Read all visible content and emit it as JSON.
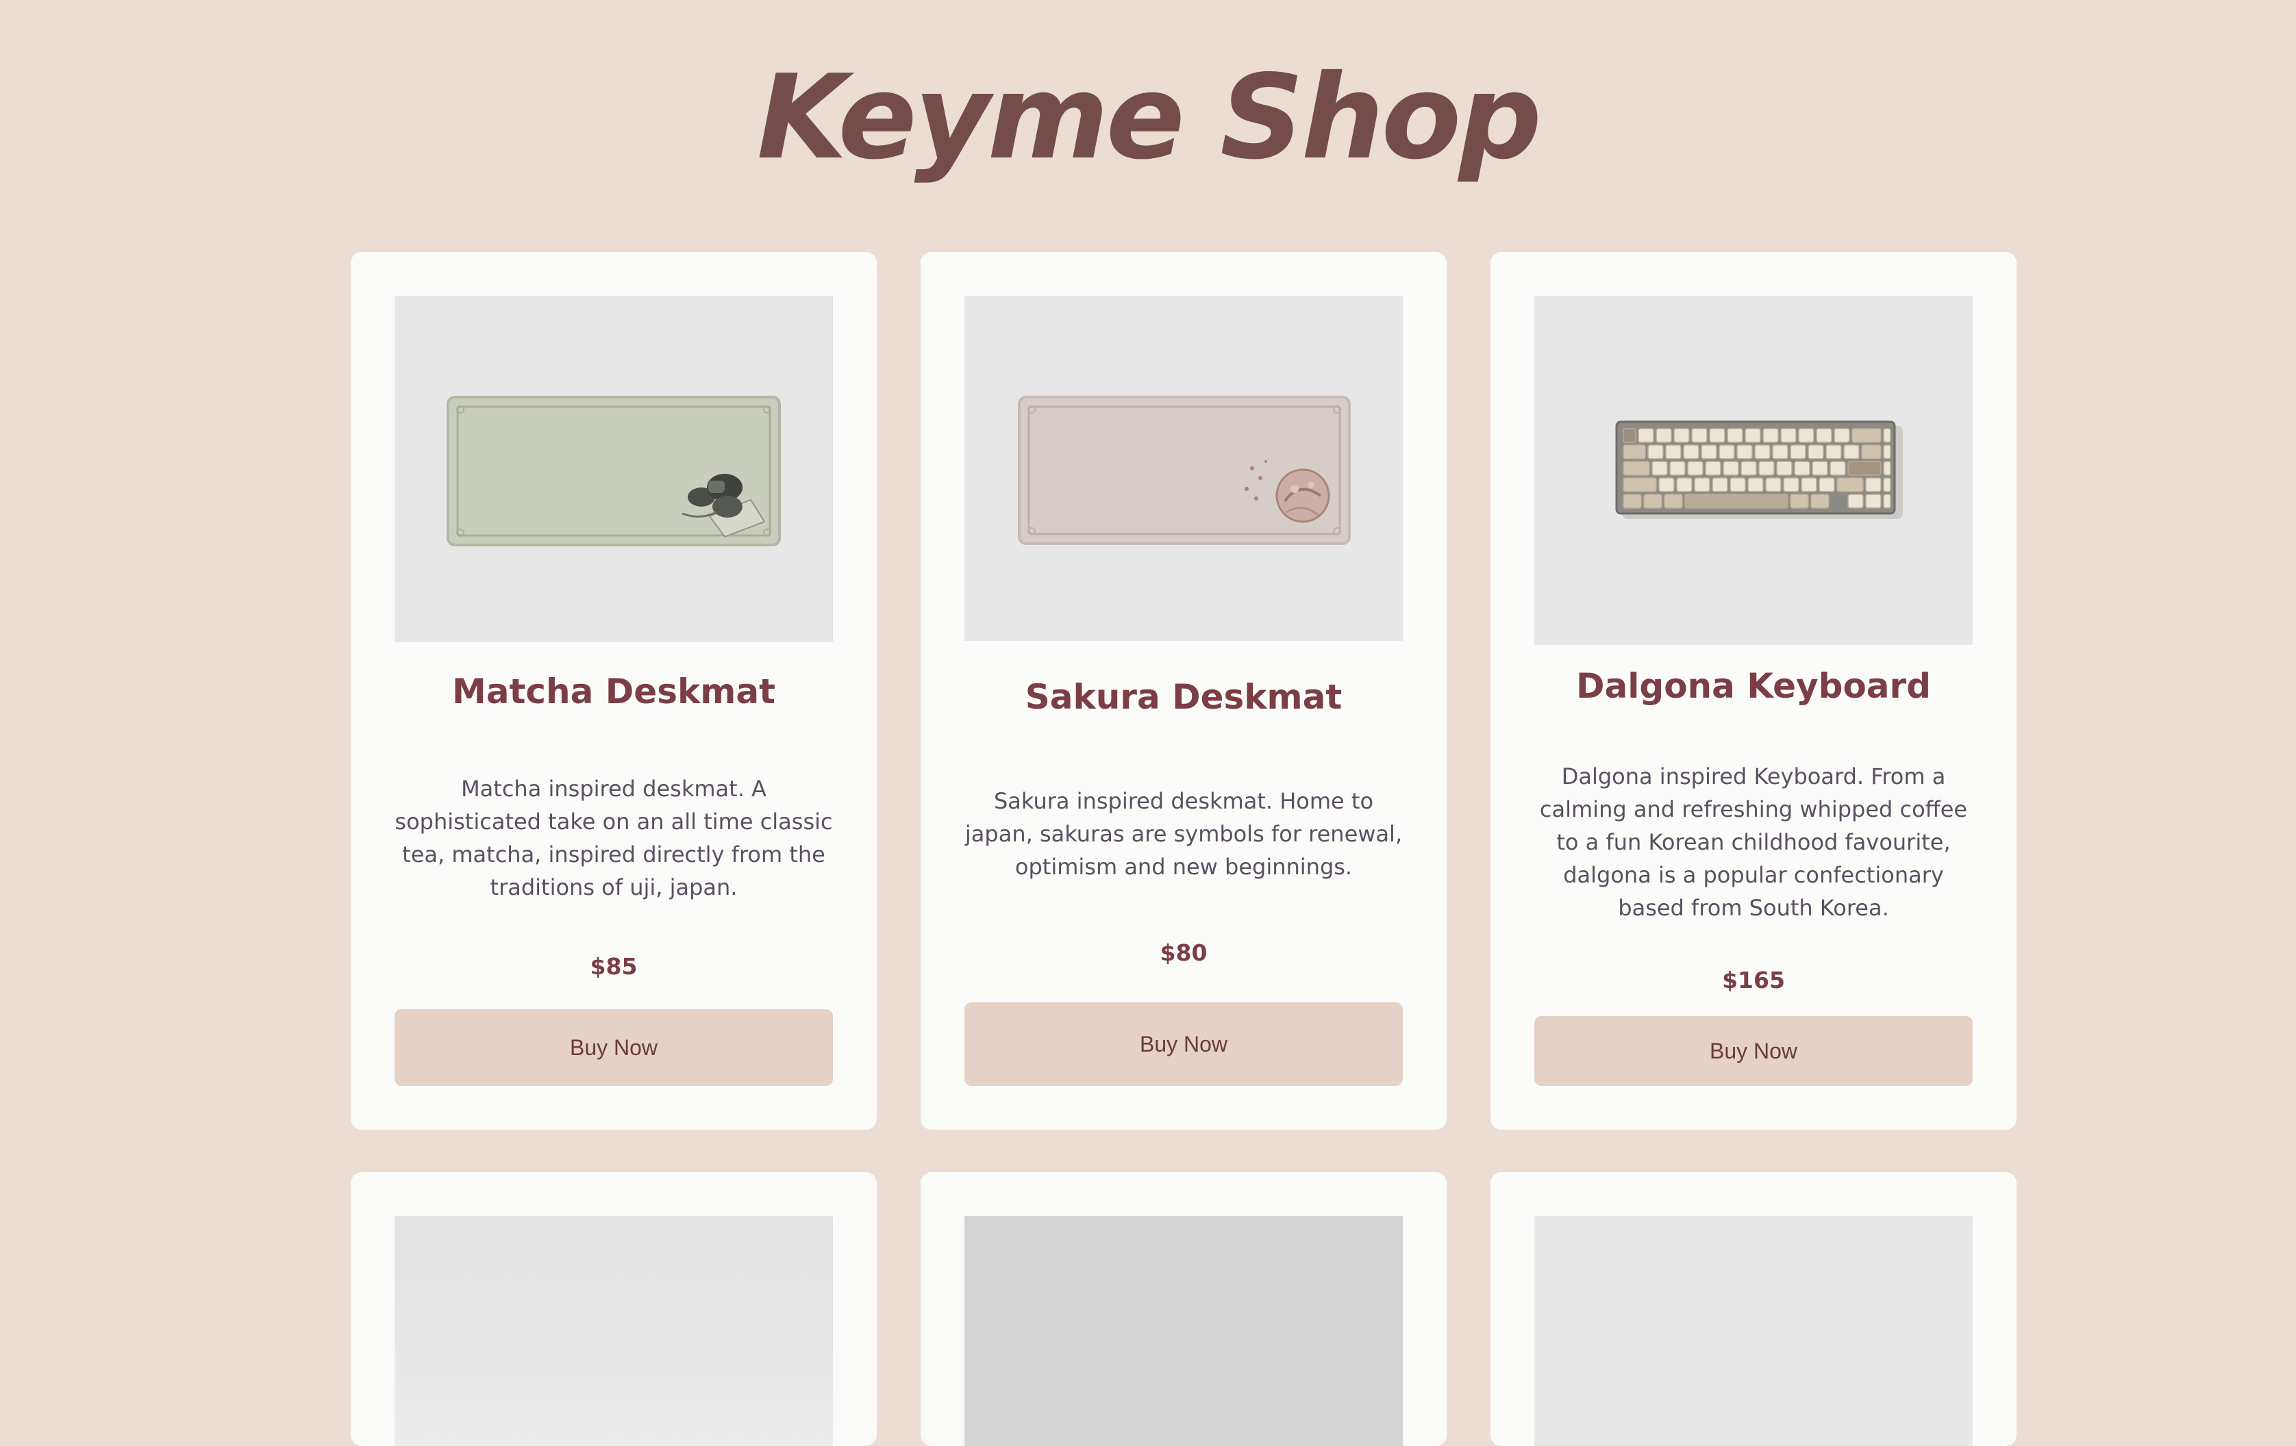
{
  "site": {
    "title": "Keyme Shop"
  },
  "colors": {
    "background": "#ebddd4",
    "card": "#fbfcfa",
    "accent": "#7b3e44",
    "button": "#e5d1c6"
  },
  "products": [
    {
      "name": "Matcha Deskmat",
      "description": "Matcha inspired deskmat. A sophisticated take on an all time classic tea, matcha, inspired directly from the traditions of uji, japan.",
      "price": "$85",
      "button_label": "Buy Now",
      "image": "matcha-deskmat-image"
    },
    {
      "name": "Sakura Deskmat",
      "description": "Sakura inspired deskmat. Home to japan, sakuras are symbols for renewal, optimism and new beginnings.",
      "price": "$80",
      "button_label": "Buy Now",
      "image": "sakura-deskmat-image"
    },
    {
      "name": "Dalgona Keyboard",
      "description": "Dalgona inspired Keyboard. From a calming and refreshing whipped coffee to a fun Korean childhood favourite, dalgona is a popular confectionary based from South Korea.",
      "price": "$165",
      "button_label": "Buy Now",
      "image": "dalgona-keyboard-image"
    }
  ]
}
